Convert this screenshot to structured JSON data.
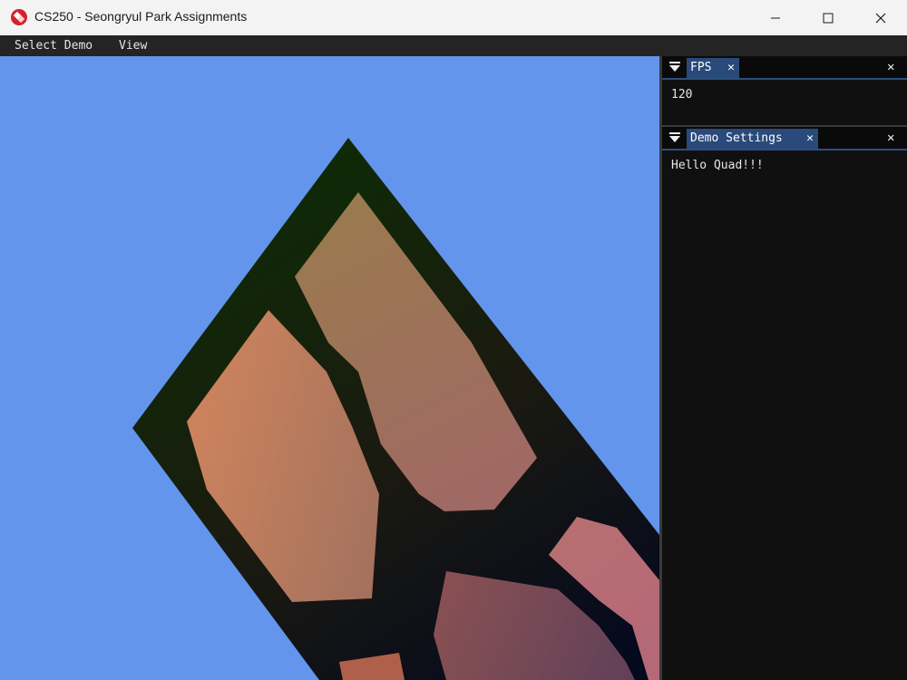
{
  "window": {
    "title": "CS250 - Seongryul Park Assignments"
  },
  "menu": {
    "items": [
      "Select Demo",
      "View"
    ]
  },
  "viewport": {
    "clear_color": "#6495ed",
    "scene": "textured quad"
  },
  "panels": {
    "fps": {
      "tab_label": "FPS",
      "tab_close": "✕",
      "value": "120",
      "close": "✕"
    },
    "demo_settings": {
      "tab_label": "Demo Settings",
      "tab_close": "✕",
      "text": "Hello Quad!!!",
      "close": "✕"
    }
  },
  "icons": {
    "window_minimize": "minimize-icon",
    "window_maximize": "maximize-icon",
    "window_close": "close-icon"
  }
}
